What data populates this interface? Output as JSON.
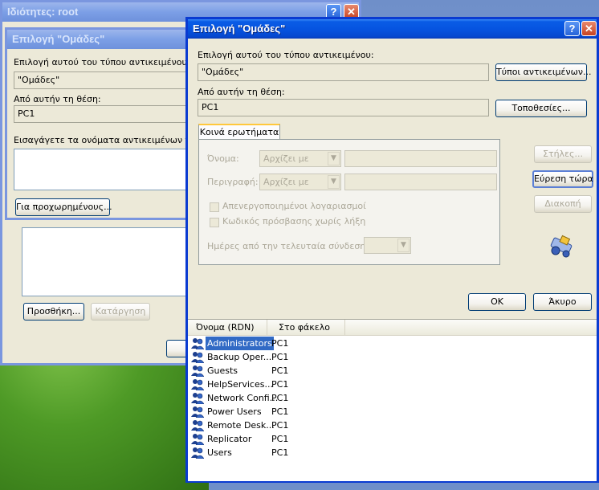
{
  "bg_window": {
    "title": "Ιδιότητες: root",
    "add_button": "Προσθήκη...",
    "remove_button": "Κατάργηση"
  },
  "middle_window": {
    "title": "Επιλογή \"Ομάδες\"",
    "object_type_label": "Επιλογή αυτού του τύπου αντικειμένου:",
    "object_type_value": "\"Ομάδες\"",
    "location_label": "Από αυτήν τη θέση:",
    "location_value": "PC1",
    "enter_names_label": "Εισαγάγετε τα ονόματα αντικειμένων για",
    "advanced_button": "Για προχωρημένους..."
  },
  "main_window": {
    "title": "Επιλογή \"Ομάδες\"",
    "object_type_label": "Επιλογή αυτού του τύπου αντικειμένου:",
    "object_type_value": "\"Ομάδες\"",
    "object_types_button": "Τύποι αντικειμένων...",
    "location_label": "Από αυτήν τη θέση:",
    "location_value": "PC1",
    "locations_button": "Τοποθεσίες...",
    "tab_label": "Κοινά ερωτήματα",
    "name_label": "Όνομα:",
    "name_combo": "Αρχίζει με",
    "description_label": "Περιγραφή:",
    "description_combo": "Αρχίζει με",
    "disabled_accounts": "Απενεργοποιημένοι λογαριασμοί",
    "non_expiring": "Κωδικός πρόσβασης χωρίς λήξη",
    "days_label": "Ημέρες από την τελευταία σύνδεση:",
    "columns_button": "Στήλες...",
    "find_now_button": "Εύρεση τώρα",
    "stop_button": "Διακοπή",
    "ok_button": "ΟΚ",
    "cancel_button": "Άκυρο",
    "results_header_name": "Όνομα (RDN)",
    "results_header_folder": "Στο φάκελο",
    "results": [
      {
        "name": "Administrators",
        "folder": "PC1"
      },
      {
        "name": "Backup Oper...",
        "folder": "PC1"
      },
      {
        "name": "Guests",
        "folder": "PC1"
      },
      {
        "name": "HelpServices...",
        "folder": "PC1"
      },
      {
        "name": "Network Confi...",
        "folder": "PC1"
      },
      {
        "name": "Power Users",
        "folder": "PC1"
      },
      {
        "name": "Remote Desk...",
        "folder": "PC1"
      },
      {
        "name": "Replicator",
        "folder": "PC1"
      },
      {
        "name": "Users",
        "folder": "PC1"
      }
    ],
    "selected_index": 0
  },
  "colors": {
    "titlebar_blue": "#0654e0",
    "selection_blue": "#316ac5",
    "dialog_face": "#ece9d8"
  }
}
